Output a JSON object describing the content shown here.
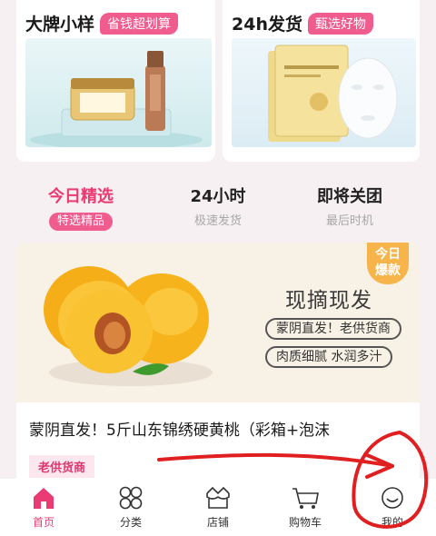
{
  "promo_cards": [
    {
      "title": "大牌小样",
      "tag": "省钱超划算"
    },
    {
      "title": "24h发货",
      "tag": "甄选好物"
    }
  ],
  "tabs": [
    {
      "title": "今日精选",
      "subtitle": "特选精品",
      "active": true
    },
    {
      "title": "24小时",
      "subtitle": "极速发货",
      "active": false
    },
    {
      "title": "即将关团",
      "subtitle": "最后时机",
      "active": false
    }
  ],
  "product": {
    "badge_line1": "今日",
    "badge_line2": "爆款",
    "slogan": "现摘现发",
    "pill_1": "蒙阴直发！老供货商",
    "pill_2": "肉质细腻 水润多汁",
    "name": "蒙阴直发！5斤山东锦绣硬黄桃（彩箱+泡沫",
    "supplier": "老供货商"
  },
  "bottom_nav": [
    {
      "label": "首页",
      "icon": "home-icon",
      "active": true
    },
    {
      "label": "分类",
      "icon": "category-icon",
      "active": false
    },
    {
      "label": "店铺",
      "icon": "shop-icon",
      "active": false
    },
    {
      "label": "购物车",
      "icon": "cart-icon",
      "active": false
    },
    {
      "label": "我的",
      "icon": "profile-icon",
      "active": false
    }
  ],
  "colors": {
    "accent": "#ea3a72",
    "tag_pink": "#f05c8e",
    "badge_orange": "#f7b44a",
    "annotation_red": "#e02020"
  }
}
